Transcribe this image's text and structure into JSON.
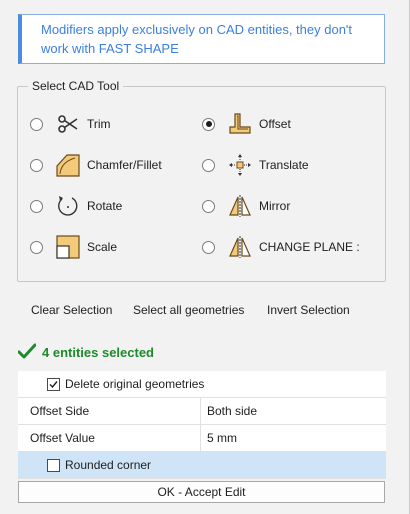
{
  "info_message": "Modifiers apply exclusively on CAD entities, they don't work with FAST SHAPE",
  "tool_group": {
    "title": "Select CAD Tool",
    "selected": "Offset",
    "tools": [
      {
        "label": "Trim",
        "icon": "scissors-icon",
        "selected": false
      },
      {
        "label": "Offset",
        "icon": "offset-icon",
        "selected": true
      },
      {
        "label": "Chamfer/Fillet",
        "icon": "chamfer-fillet-icon",
        "selected": false
      },
      {
        "label": "Translate",
        "icon": "translate-icon",
        "selected": false
      },
      {
        "label": "Rotate",
        "icon": "rotate-icon",
        "selected": false
      },
      {
        "label": "Mirror",
        "icon": "mirror-icon",
        "selected": false
      },
      {
        "label": "Scale",
        "icon": "scale-icon",
        "selected": false
      },
      {
        "label": "CHANGE PLANE :",
        "icon": "change-plane-icon",
        "selected": false
      }
    ]
  },
  "actions": {
    "clear": "Clear Selection",
    "select_all": "Select all geometries",
    "invert": "Invert Selection"
  },
  "status": {
    "text": "4 entities selected",
    "color": "#1e8a2c"
  },
  "properties": {
    "delete_original": {
      "label": "Delete original geometries",
      "checked": true
    },
    "offset_side": {
      "key": "Offset Side",
      "value": "Both side"
    },
    "offset_value": {
      "key": "Offset Value",
      "value": "5 mm"
    },
    "rounded_corner": {
      "label": "Rounded corner",
      "checked": false
    }
  },
  "ok_button": "OK - Accept Edit",
  "colors": {
    "accent": "#4c8be0",
    "info_text": "#3b7fe0",
    "selected_row": "#cfe5f7",
    "icon_fill": "#f0c060"
  }
}
